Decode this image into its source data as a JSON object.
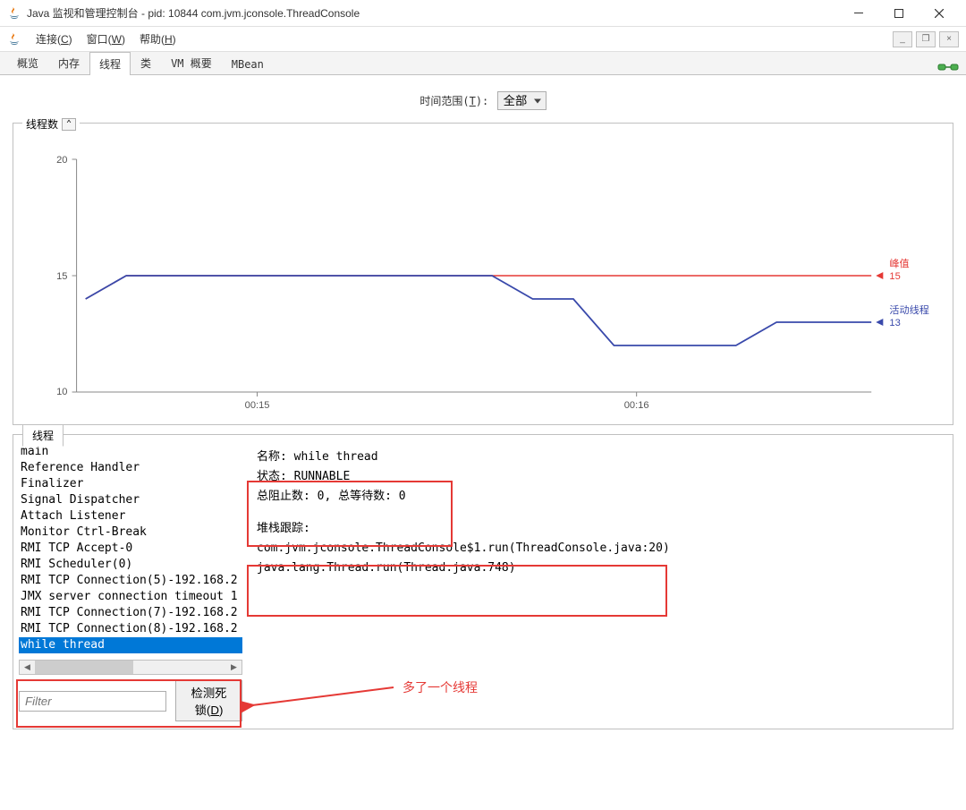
{
  "window": {
    "title": "Java 监视和管理控制台 - pid: 10844 com.jvm.jconsole.ThreadConsole"
  },
  "menu": {
    "connect": "连接(C)",
    "window": "窗口(W)",
    "help": "帮助(H)"
  },
  "tabs": [
    "概览",
    "内存",
    "线程",
    "类",
    "VM 概要",
    "MBean"
  ],
  "active_tab_index": 2,
  "timerange": {
    "label": "时间范围(T):",
    "selected": "全部"
  },
  "chart_fieldset_title": "线程数",
  "chart_data": {
    "type": "line",
    "ylim": [
      10,
      20
    ],
    "y_ticks": [
      10,
      15,
      20
    ],
    "x_ticks": [
      "00:15",
      "00:16"
    ],
    "series": [
      {
        "name": "峰值",
        "color": "#e53935",
        "values": [
          14,
          15,
          15,
          15,
          15,
          15,
          15,
          15,
          15,
          15,
          15,
          15,
          15,
          15,
          15,
          15,
          15,
          15,
          15,
          15
        ],
        "current": 15
      },
      {
        "name": "活动线程",
        "color": "#3949ab",
        "values": [
          14,
          15,
          15,
          15,
          15,
          15,
          15,
          15,
          15,
          15,
          15,
          14,
          14,
          12,
          12,
          12,
          12,
          13,
          13,
          13
        ],
        "current": 13
      }
    ],
    "labels": {
      "peak": "峰值",
      "active": "活动线程"
    }
  },
  "threads_tab_label": "线程",
  "thread_list": [
    "main",
    "Reference Handler",
    "Finalizer",
    "Signal Dispatcher",
    "Attach Listener",
    "Monitor Ctrl-Break",
    "RMI TCP Accept-0",
    "RMI Scheduler(0)",
    "RMI TCP Connection(5)-192.168.2",
    "JMX server connection timeout 1",
    "RMI TCP Connection(7)-192.168.2",
    "RMI TCP Connection(8)-192.168.2",
    "while thread"
  ],
  "selected_thread_index": 12,
  "filter_placeholder": "Filter",
  "detect_deadlock": "检测死锁(D)",
  "detail": {
    "name_label": "名称: ",
    "name_value": "while thread",
    "state_label": "状态: ",
    "state_value": "RUNNABLE",
    "blocked_label": "总阻止数: ",
    "blocked_value": "0",
    "waited_label": ", 总等待数: ",
    "waited_value": "0",
    "stack_label": "堆栈跟踪:",
    "stack_lines": [
      "com.jvm.jconsole.ThreadConsole$1.run(ThreadConsole.java:20)",
      "java.lang.Thread.run(Thread.java:748)"
    ]
  },
  "annotation": {
    "extra_thread": "多了一个线程"
  }
}
